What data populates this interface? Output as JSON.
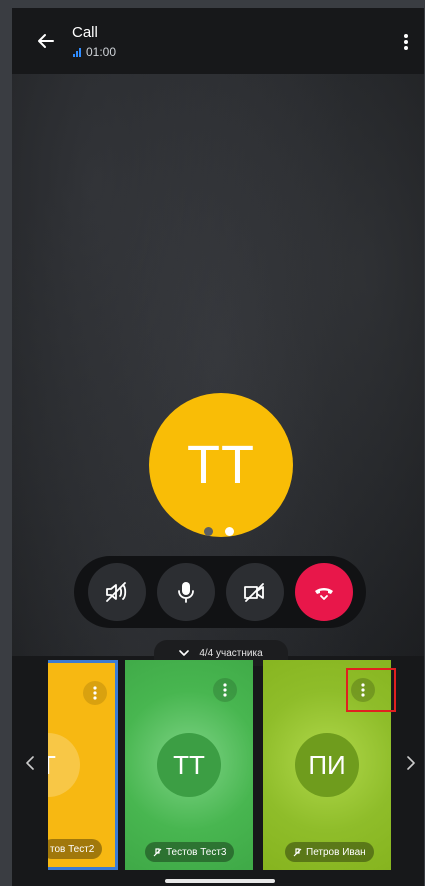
{
  "header": {
    "title": "Call",
    "timer": "01:00"
  },
  "caller": {
    "initials": "TT"
  },
  "controls": {
    "speaker_icon": "speaker-off-icon",
    "mic_icon": "mic-icon",
    "camera_icon": "camera-off-icon",
    "end_icon": "end-call-icon",
    "end_color": "#e8174a"
  },
  "participants_toggle": {
    "label": "4/4 участника"
  },
  "participants": [
    {
      "initials": "T",
      "name": "тов Тест2",
      "color": "#f7b812"
    },
    {
      "initials": "ТТ",
      "name": "Тестов Тест3",
      "color": "#48b650"
    },
    {
      "initials": "ПИ",
      "name": "Петров Иван",
      "color": "#8fbd2a"
    }
  ],
  "colors": {
    "accent_selected": "#3a7bd5",
    "highlight": "#e02020"
  }
}
